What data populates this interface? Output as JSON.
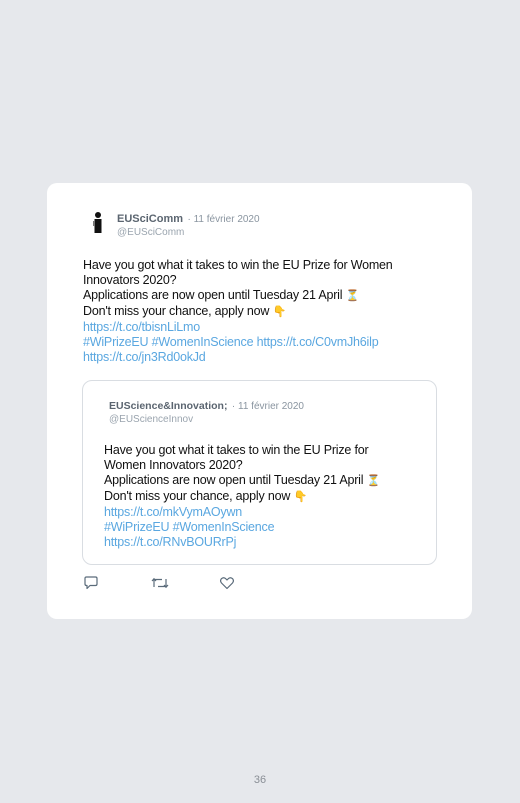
{
  "tweet": {
    "author": "EUSciComm",
    "date": "· 11 février 2020",
    "handle": "@EUSciComm",
    "lines": [
      "Have you got what it takes to win the EU Prize for Women",
      "Innovators 2020?",
      "Applications are now open until Tuesday 21 April",
      "Don't miss your chance, apply now"
    ],
    "emoji_hourglass": "⏳",
    "emoji_point": "👇",
    "links": [
      "https://t.co/tbisnLiLmo",
      "#WiPrizeEU #WomenInScience https://t.co/C0vmJh6ilp",
      "https://t.co/jn3Rd0okJd"
    ]
  },
  "quoted": {
    "author": "EUScience&Innovation;",
    "date": "· 11 février 2020",
    "handle": "@EUScienceInnov",
    "lines": [
      "Have you got what it takes to win the EU Prize for",
      "Women Innovators 2020?",
      "Applications are now open until Tuesday 21 April",
      "Don't miss your chance, apply now"
    ],
    "links": [
      "https://t.co/mkVymAOywn",
      "#WiPrizeEU #WomenInScience",
      "https://t.co/RNvBOURrPj"
    ]
  },
  "icons": {
    "reply": "reply-icon",
    "retweet": "retweet-icon",
    "like": "like-icon",
    "avatar": "person-silhouette-icon"
  },
  "colors": {
    "link": "#5aa7e0",
    "page_bg": "#e6e8ec"
  },
  "page_number": "36"
}
